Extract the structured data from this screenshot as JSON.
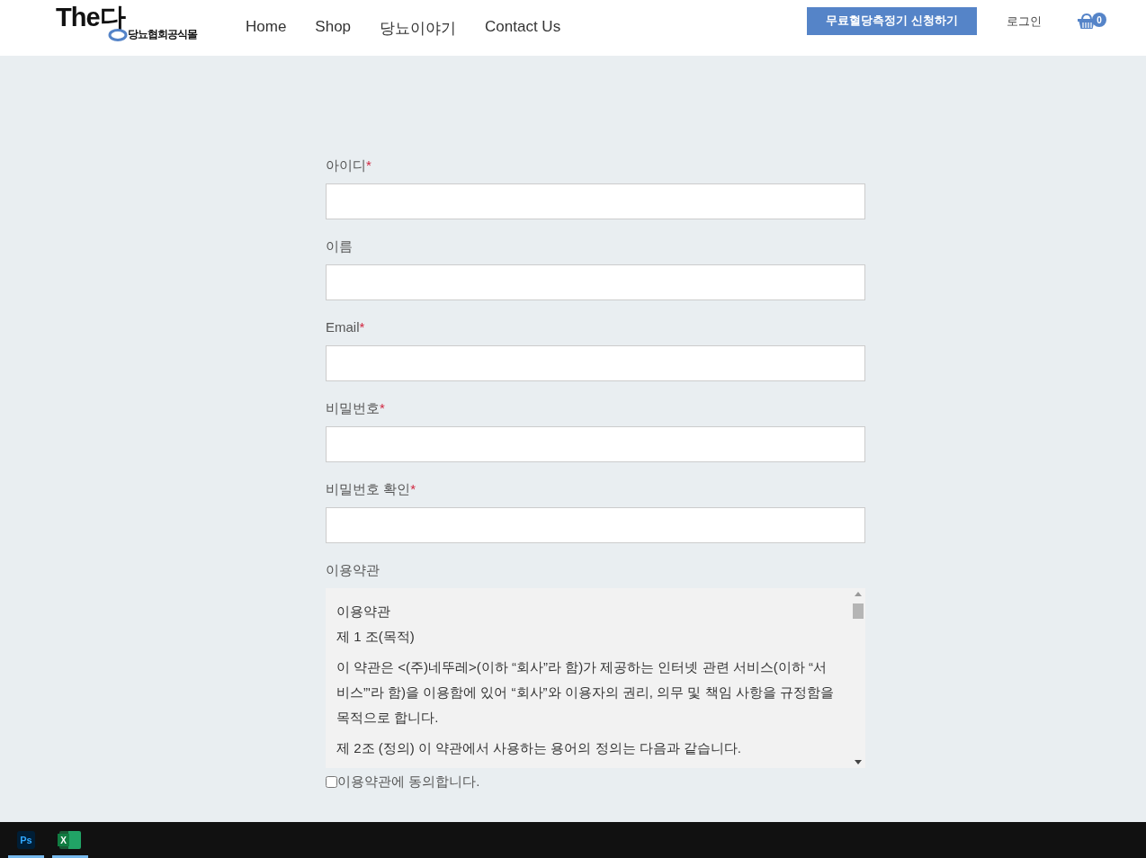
{
  "header": {
    "logo": {
      "title": "The다",
      "subtitle": "당뇨협회공식몰"
    },
    "nav": [
      {
        "label": "Home"
      },
      {
        "label": "Shop"
      },
      {
        "label": "당뇨이야기"
      },
      {
        "label": "Contact Us"
      }
    ],
    "cta_button": "무료혈당측정기 신청하기",
    "login": "로그인",
    "cart_count": "0"
  },
  "form": {
    "fields": [
      {
        "label": "아이디",
        "required_mark": "*"
      },
      {
        "label": "이름"
      },
      {
        "label": "Email",
        "required_mark": "*"
      },
      {
        "label": "비밀번호",
        "required_mark": "*"
      },
      {
        "label": "비밀번호 확인",
        "required_mark": "*"
      }
    ],
    "terms": {
      "label": "이용약관",
      "paragraphs": [
        "이용약관",
        "제 1 조(목적)",
        "이 약관은 <(주)네뚜레>(이하 “회사”라 함)가 제공하는 인터넷 관련 서비스(이하 “서비스”'라 함)을 이용함에 있어 “회사”와 이용자의 권리, 의무 및 책임 사항을 규정함을 목적으로 합니다.",
        "제 2조 (정의) 이 약관에서 사용하는 용어의 정의는 다음과 같습니다."
      ],
      "agree": {
        "label": "이용약관에 동의합니다.",
        "checked": false
      }
    }
  },
  "taskbar": {
    "apps": [
      {
        "kind": "photoshop",
        "label": "Ps",
        "running": true
      },
      {
        "kind": "excel",
        "label": "X",
        "running": true
      }
    ]
  }
}
